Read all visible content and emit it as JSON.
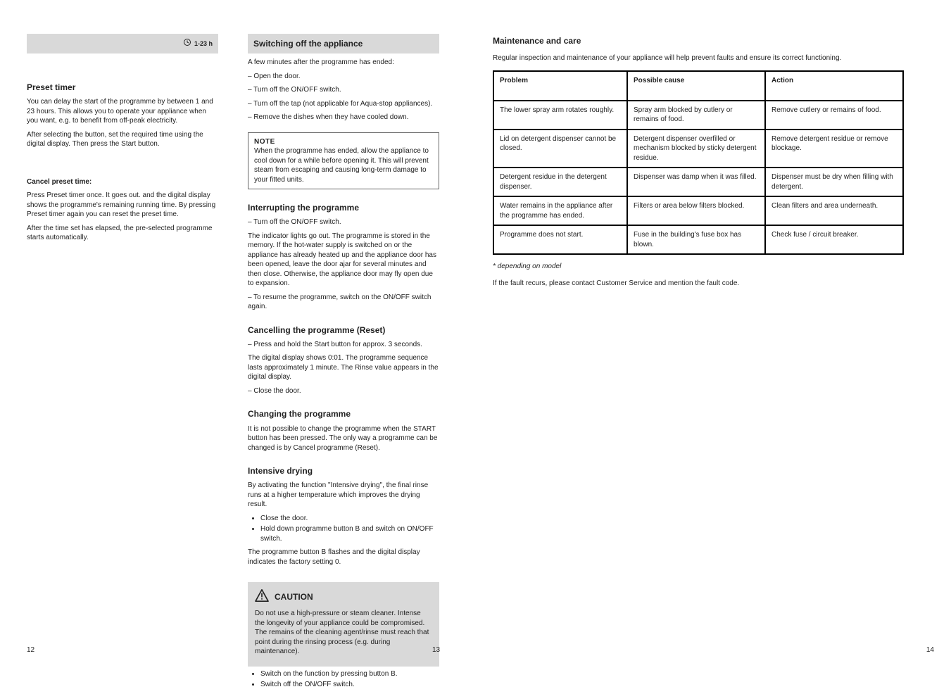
{
  "page1": {
    "clock_label": "1-23 h",
    "section_title": "Preset timer",
    "para1": "You can delay the start of the programme by between 1 and 23 hours. This allows you to operate your appliance when you want, e.g. to benefit from off-peak electricity.",
    "para2": "After selecting the button, set the required time using the digital display. Then press the Start button.",
    "para3": "Press Preset timer once. It goes out. and the digital display shows the programme's remaining running time. By pressing Preset timer again you can reset the preset time.",
    "para4": "After the time set has elapsed, the pre-selected programme starts automatically.",
    "cancel_title": "Cancel preset time:",
    "pagenum": "12"
  },
  "page2": {
    "header": "Switching off the appliance",
    "sub1": "A few minutes after the programme has ended:",
    "step1": "– Open the door.",
    "step2": "– Turn off the ON/OFF switch.",
    "step3": "– Turn off the tap (not applicable for Aqua-stop appliances).",
    "step4": "– Remove the dishes when they have cooled down.",
    "note_title": "NOTE",
    "note_body": "When the programme has ended, allow the appliance to cool down for a while before opening it. This will prevent steam from escaping and causing long-term damage to your fitted units.",
    "sec2_title": "Interrupting the programme",
    "sec2_step1": "– Turn off the ON/OFF switch.",
    "sec2_para": "The indicator lights go out. The programme is stored in the memory. If the hot-water supply is switched on or the appliance has already heated up and the appliance door has been opened, leave the door ajar for several minutes and then close. Otherwise, the appliance door may fly open due to expansion.",
    "sec2_step2": "– To resume the programme, switch on the ON/OFF switch again.",
    "sec3_title": "Cancelling the programme (Reset)",
    "sec3_step1": "– Press and hold the Start button for approx. 3 seconds.",
    "sec3_para": "The digital display shows 0:01. The programme sequence lasts approximately 1 minute. The Rinse value appears in the digital display.",
    "sec3_step2": "– Close the door.",
    "sec4_title": "Changing the programme",
    "sec4_para": "It is not possible to change the programme when the START button has been pressed. The only way a programme can be changed is by Cancel programme (Reset).",
    "sec5_title": "Intensive drying",
    "sec5_para": "By activating the function \"Intensive drying\", the final rinse runs at a higher temperature which improves the drying result.",
    "sec5_item1": "Close the door.",
    "sec5_item2": "Hold down programme button B and switch on ON/OFF switch.",
    "sec6_para": "The programme button B flashes and the digital display indicates the factory setting 0.",
    "caution_title": "CAUTION",
    "caution_body": "Do not use a high-pressure or steam cleaner. Intense the longevity of your appliance could be compromised. The remains of the cleaning agent/rinse must reach that point during the rinsing process (e.g. during maintenance).",
    "sec7_item1": "Switch on the function by pressing button B.",
    "sec7_item2": "Switch off the ON/OFF switch.",
    "pagenum": "13"
  },
  "page3": {
    "title": "Maintenance and care",
    "intro": "Regular inspection and maintenance of your appliance will help prevent faults and ensure its correct functioning.",
    "table": {
      "headers": [
        "Problem",
        "Possible cause",
        "Action"
      ],
      "rows": [
        [
          "The lower spray arm rotates roughly.",
          "Spray arm blocked by cutlery or remains of food.",
          "Remove cutlery or remains of food."
        ],
        [
          "Lid on detergent dispenser cannot be closed.",
          "Detergent dispenser overfilled or mechanism blocked by sticky detergent residue.",
          "Remove detergent residue or remove blockage."
        ],
        [
          "Detergent residue in the detergent dispenser.",
          "Dispenser was damp when it was filled.",
          "Dispenser must be dry when filling with detergent."
        ],
        [
          "Water remains in the appliance after the programme has ended.",
          "Filters or area below filters blocked.",
          "Clean filters and area underneath."
        ],
        [
          "Programme does not start.",
          "Fuse in the building's fuse box has blown.",
          "Check fuse / circuit breaker."
        ]
      ]
    },
    "footnote_italic": "* depending on model",
    "footnote_para": "If the fault recurs, please contact Customer Service and mention the fault code.",
    "pagenum": "14"
  }
}
